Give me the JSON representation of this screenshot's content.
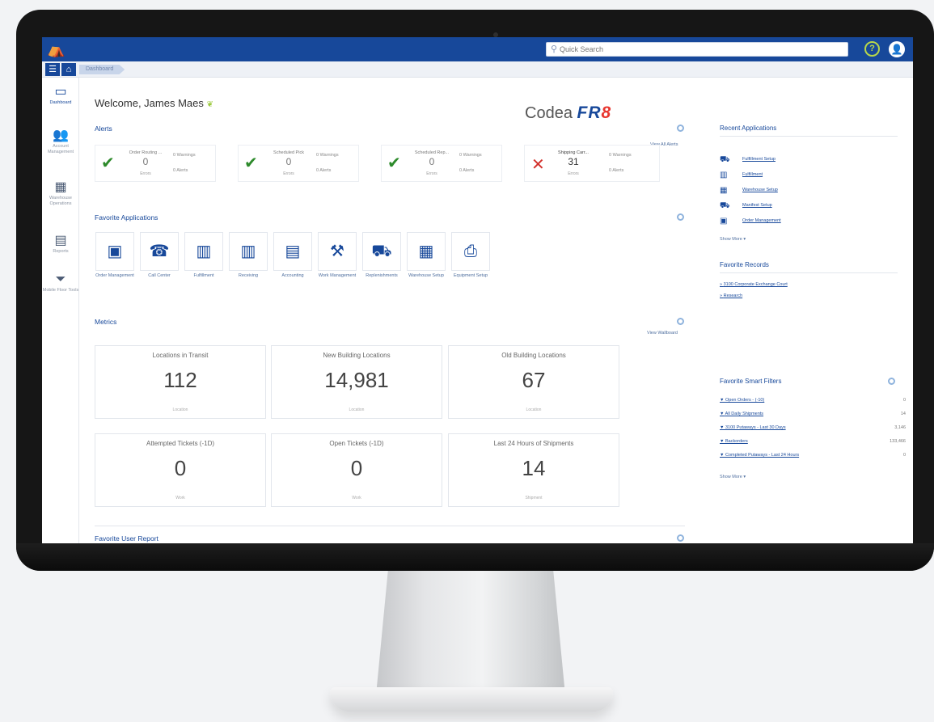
{
  "topbar": {
    "search_placeholder": "Quick Search",
    "help_label": "?"
  },
  "breadcrumb": {
    "label": "Dashboard"
  },
  "leftnav": [
    {
      "icon": "dashboard-icon",
      "label": "Dashboard",
      "active": true
    },
    {
      "icon": "users-icon",
      "label": "Account Management"
    },
    {
      "icon": "warehouse-icon",
      "label": "Warehouse Operations"
    },
    {
      "icon": "reports-icon",
      "label": "Reports"
    },
    {
      "icon": "smart-filter-icon",
      "label": "Mobile Floor Tools"
    }
  ],
  "welcome": "Welcome, James Maes",
  "brand": {
    "prefix": "Codea ",
    "mark": "FR",
    "mark_end": "8"
  },
  "alerts": {
    "title": "Alerts",
    "view_all": "View All Alerts",
    "items": [
      {
        "name": "Order Routing ...",
        "count": "0",
        "unit": "Errors",
        "warnings": "0 Warnings",
        "alerts": "0 Alerts",
        "status": "ok"
      },
      {
        "name": "Scheduled Pick",
        "count": "0",
        "unit": "Errors",
        "warnings": "0 Warnings",
        "alerts": "0 Alerts",
        "status": "ok"
      },
      {
        "name": "Scheduled Rep...",
        "count": "0",
        "unit": "Errors",
        "warnings": "0 Warnings",
        "alerts": "0 Alerts",
        "status": "ok"
      },
      {
        "name": "Shipping Carr...",
        "count": "31",
        "unit": "Errors",
        "warnings": "0 Warnings",
        "alerts": "0 Alerts",
        "status": "error"
      }
    ]
  },
  "favorite_apps": {
    "title": "Favorite Applications",
    "items": [
      {
        "icon": "order-icon",
        "label": "Order Management"
      },
      {
        "icon": "call-center-icon",
        "label": "Call Center"
      },
      {
        "icon": "fulfillment-icon",
        "label": "Fulfillment"
      },
      {
        "icon": "receiving-icon",
        "label": "Receiving"
      },
      {
        "icon": "accounting-icon",
        "label": "Accounting"
      },
      {
        "icon": "work-icon",
        "label": "Work Management"
      },
      {
        "icon": "replenishment-icon",
        "label": "Replenishments"
      },
      {
        "icon": "warehouse-setup-icon",
        "label": "Warehouse Setup"
      },
      {
        "icon": "equipment-icon",
        "label": "Equipment Setup"
      }
    ]
  },
  "metrics": {
    "title": "Metrics",
    "view_wallboard": "View Wallboard",
    "items": [
      {
        "title": "Locations in Transit",
        "value": "112",
        "unit": "Location"
      },
      {
        "title": "New Building Locations",
        "value": "14,981",
        "unit": "Location"
      },
      {
        "title": "Old Building Locations",
        "value": "67",
        "unit": "Location"
      },
      {
        "title": "Attempted Tickets (-1D)",
        "value": "0",
        "unit": "Work"
      },
      {
        "title": "Open Tickets (-1D)",
        "value": "0",
        "unit": "Work"
      },
      {
        "title": "Last 24 Hours of Shipments",
        "value": "14",
        "unit": "Shipment"
      }
    ]
  },
  "favorite_user_report": {
    "title": "Favorite User Report"
  },
  "recent_apps": {
    "title": "Recent Applications",
    "items": [
      {
        "icon": "fulfillment-setup-icon",
        "label": "Fulfillment Setup"
      },
      {
        "icon": "fulfillment-icon",
        "label": "Fulfillment"
      },
      {
        "icon": "warehouse-setup-icon",
        "label": "Warehouse Setup"
      },
      {
        "icon": "manifest-icon",
        "label": "Manifest Setup"
      },
      {
        "icon": "order-icon",
        "label": "Order Management"
      }
    ],
    "show_more": "Show More"
  },
  "favorite_records": {
    "title": "Favorite Records",
    "items": [
      "3100 Corporate Exchange Court",
      "Research"
    ]
  },
  "smart_filters": {
    "title": "Favorite Smart Filters",
    "items": [
      {
        "label": "Open Orders - (-10)",
        "count": "0"
      },
      {
        "label": "All Daily Shipments",
        "count": "14"
      },
      {
        "label": "3100 Putaways - Last 30 Days",
        "count": "3,146"
      },
      {
        "label": "Backorders",
        "count": "133,466"
      },
      {
        "label": "Completed Putaways - Last 24 Hours",
        "count": "0"
      }
    ],
    "show_more": "Show More"
  },
  "colors": {
    "brand_blue": "#17489a",
    "success_green": "#2d8a2b",
    "error_red": "#d2302b",
    "help_green": "#b8d84a"
  }
}
